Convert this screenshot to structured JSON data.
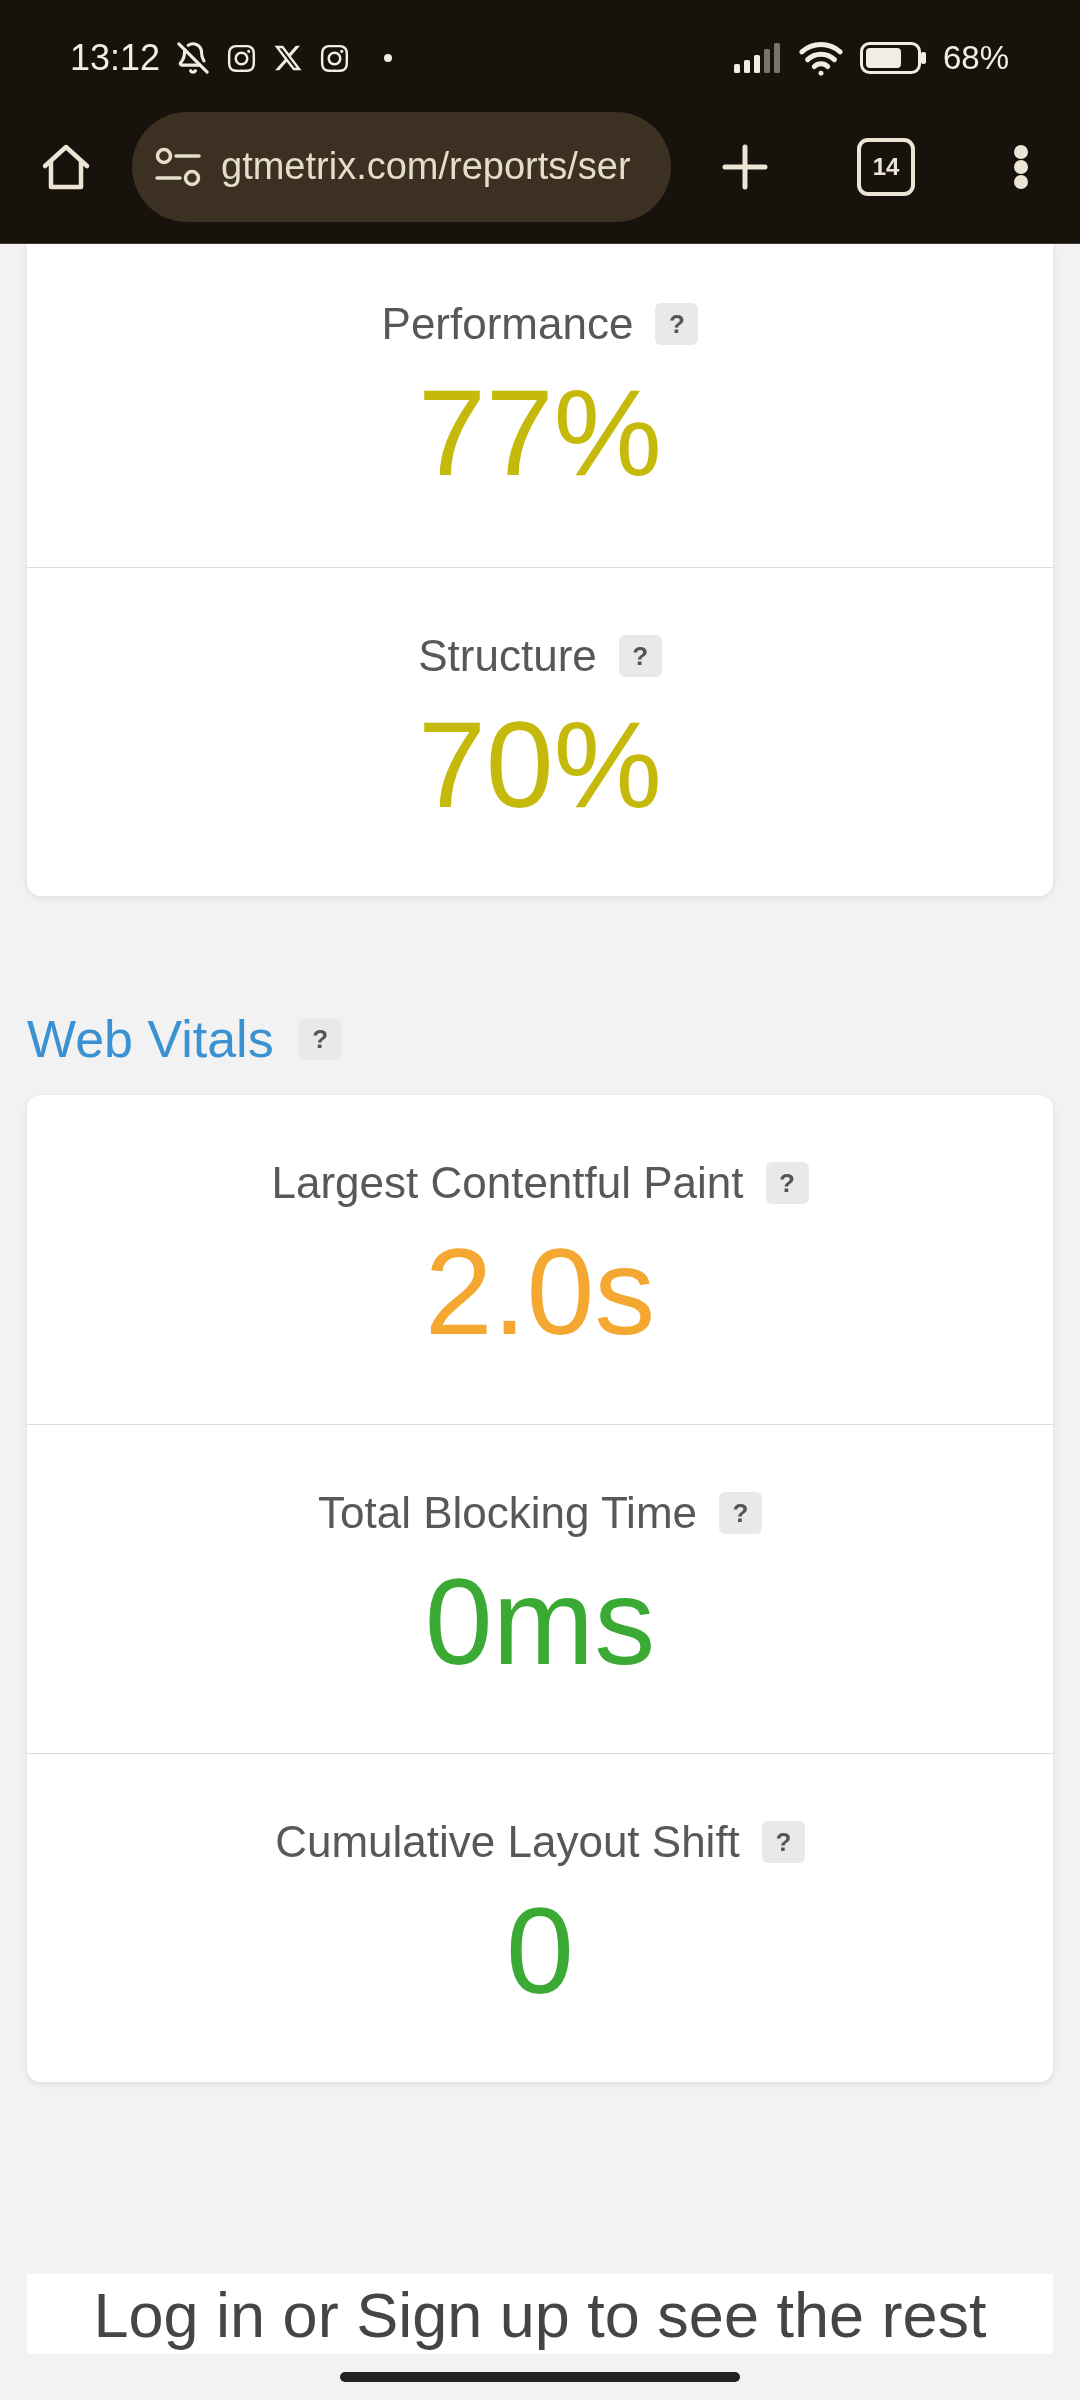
{
  "status_bar": {
    "time": "13:12",
    "battery_percent": "68%"
  },
  "browser_toolbar": {
    "url": "gtmetrix.com/reports/ser",
    "tab_count": "14"
  },
  "scores_card": {
    "metrics": [
      {
        "label": "Performance",
        "help": "?",
        "value": "77%",
        "color": "#c5b90b"
      },
      {
        "label": "Structure",
        "help": "?",
        "value": "70%",
        "color": "#c5b90b"
      }
    ]
  },
  "web_vitals": {
    "title": "Web Vitals",
    "help": "?",
    "metrics": [
      {
        "label": "Largest Contentful Paint",
        "help": "?",
        "value": "2.0s",
        "color": "#f4a731"
      },
      {
        "label": "Total Blocking Time",
        "help": "?",
        "value": "0ms",
        "color": "#3aaa35"
      },
      {
        "label": "Cumulative Layout Shift",
        "help": "?",
        "value": "0",
        "color": "#3aaa35"
      }
    ]
  },
  "login_prompt": {
    "text": "Log in or Sign up to see the rest"
  }
}
